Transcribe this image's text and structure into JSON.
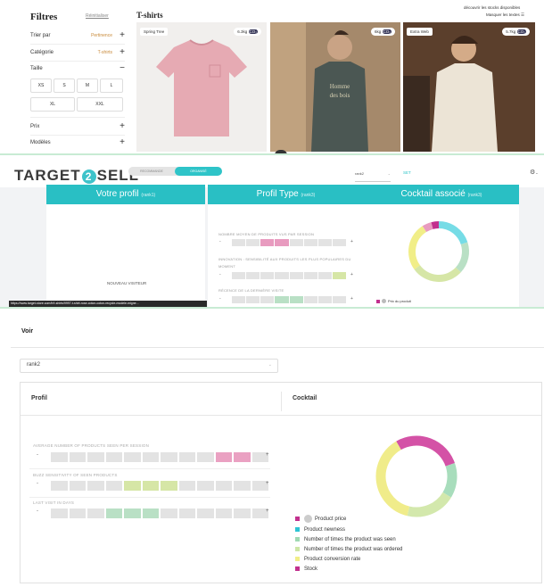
{
  "filters": {
    "title": "Filtres",
    "reset": "Réinitialiser",
    "sort": {
      "label": "Trier par",
      "value": "Pertinence",
      "sign": "+"
    },
    "category": {
      "label": "Catégorie",
      "value": "T-shirts",
      "sign": "+"
    },
    "size": {
      "label": "Taille",
      "sign": "−"
    },
    "sizes_row1": [
      "XS",
      "S",
      "M",
      "L"
    ],
    "sizes_row2": [
      "XL",
      "XXL"
    ],
    "price": {
      "label": "Prix",
      "sign": "+"
    },
    "models": {
      "label": "Modèles",
      "sign": "+"
    }
  },
  "catalog": {
    "title": "T-shirts",
    "stock_link": "découvrir les stocks disponibles",
    "hide_text": "Masquer les textes",
    "products": [
      {
        "tag": "Spring Tree",
        "co2": "6.3kg"
      },
      {
        "tag": "",
        "co2": "6kg",
        "print": "Homme des bois"
      },
      {
        "tag": "Extra Web",
        "co2": "5.7kg"
      }
    ],
    "co2_badge": "CO₂"
  },
  "widget": {
    "logo_left": "TARGET",
    "logo_mid": "2",
    "logo_right": "SELL",
    "toggle_off": "RECOMMANDE",
    "toggle_on": "ORGANISÉ",
    "rank_value": "rank2",
    "set_label": "SET",
    "gear": "⚙",
    "headers": {
      "profile": "Votre profil",
      "profile_sub": "(rank1)",
      "type": "Profil Type",
      "type_sub": "(rank3)",
      "cocktail": "Cocktail associé",
      "cocktail_sub": "(rank3)"
    },
    "visitor": "NOUVEAU VISITEUR",
    "url": "https://www.target-store.com/fr/t-shirts/9997-t-shirt-rose-coton-coton-recycle-modele-migne...",
    "metrics": [
      "NOMBRE MOYEN DE PRODUITS VUS PAR SESSION",
      "INNOVATION : SENSIBILITÉ AUX PRODUITS LES PLUS POPULAIRES DU MOMENT",
      "RÉCENCE DE LA DERNIÈRE VISITE"
    ],
    "legend_item": "Prix du produit"
  },
  "detail": {
    "voir": "Voir",
    "select_value": "rank2",
    "profile_title": "Profil",
    "cocktail_title": "Cocktail",
    "metrics": [
      "AVERAGE NUMBER OF PRODUCTS SEEN PER SESSION",
      "BUZZ SENSITIVITY OF SEEN PRODUCTS",
      "LAST VISIT IN DAYS"
    ],
    "minus": "-",
    "plus": "+",
    "legend": [
      {
        "label": "Product price",
        "color": "#c2308e"
      },
      {
        "label": "Product newness",
        "color": "#2ec4d4"
      },
      {
        "label": "Number of times the product was seen",
        "color": "#9fd9b3"
      },
      {
        "label": "Number of times the product was ordered",
        "color": "#cde6a6"
      },
      {
        "label": "Product conversion rate",
        "color": "#f1ee88"
      },
      {
        "label": "Stock",
        "color": "#c2308e"
      }
    ]
  },
  "chart_data": [
    {
      "type": "pie",
      "categories": [
        "Product newness",
        "Number of times the product was seen",
        "Number of times the product was ordered",
        "Product conversion rate",
        "Product price",
        "Stock"
      ],
      "values": [
        20,
        17,
        28,
        26,
        5,
        4
      ]
    },
    {
      "type": "pie",
      "categories": [
        "Product price",
        "Number of times the product was seen",
        "Number of times the product was ordered",
        "Product conversion rate"
      ],
      "values": [
        28,
        14,
        20,
        38
      ]
    }
  ],
  "colors": {
    "accent": "#29bfc4",
    "pink": "#e89bbf",
    "green_light": "#b9e0c5",
    "lime": "#d6e6a6"
  }
}
